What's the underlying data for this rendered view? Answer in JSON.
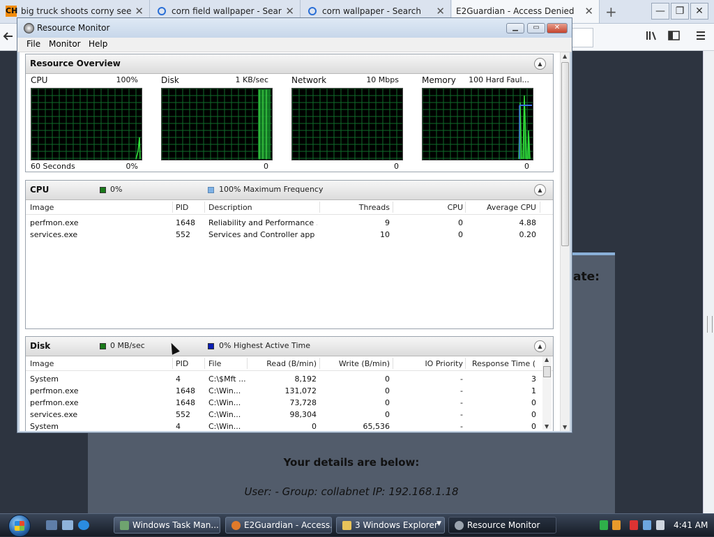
{
  "browser": {
    "tabs": [
      {
        "label": "big truck shoots corny seeds",
        "favicon": "CH",
        "icon": "ch-favicon-icon"
      },
      {
        "label": "corn field wallpaper - Search",
        "icon": "search-icon"
      },
      {
        "label": "corn wallpaper - Search",
        "icon": "search-icon"
      },
      {
        "label": "E2Guardian - Access Denied",
        "active": true
      }
    ],
    "close_glyph": "✕",
    "new_tab_glyph": "+"
  },
  "page": {
    "partial_heading": "ate:",
    "details_heading": "Your details are below:",
    "details_line": "User: -    Group: collabnet    IP: 192.168.1.18"
  },
  "resource_monitor": {
    "title": "Resource Monitor",
    "menu": [
      "File",
      "Monitor",
      "Help"
    ],
    "overview": {
      "title": "Resource Overview",
      "graphs": [
        {
          "name": "CPU",
          "max": "100%",
          "bottom_left": "60 Seconds",
          "bottom_right": "0%"
        },
        {
          "name": "Disk",
          "max": "1 KB/sec",
          "bottom_left": "",
          "bottom_right": "0"
        },
        {
          "name": "Network",
          "max": "10 Mbps",
          "bottom_left": "",
          "bottom_right": "0"
        },
        {
          "name": "Memory",
          "max": "100 Hard Faul...",
          "bottom_left": "",
          "bottom_right": "0"
        }
      ]
    },
    "cpu": {
      "title": "CPU",
      "legend1": "0%",
      "legend2": "100% Maximum Frequency",
      "legend1_color": "#1a7a1a",
      "legend2_color": "#7fb2e5",
      "columns": [
        "Image",
        "PID",
        "Description",
        "Threads",
        "CPU",
        "Average CPU"
      ],
      "rows": [
        [
          "perfmon.exe",
          "1648",
          "Reliability and Performance ...",
          "9",
          "0",
          "4.88"
        ],
        [
          "services.exe",
          "552",
          "Services and Controller app",
          "10",
          "0",
          "0.20"
        ]
      ]
    },
    "disk": {
      "title": "Disk",
      "legend1": "0 MB/sec",
      "legend2": "0% Highest Active Time",
      "legend1_color": "#1a7a1a",
      "legend2_color": "#0a1eb4",
      "columns": [
        "Image",
        "PID",
        "File",
        "Read (B/min)",
        "Write (B/min)",
        "IO Priority",
        "Response Time (..."
      ],
      "rows": [
        [
          "System",
          "4",
          "C:\\$Mft ...",
          "8,192",
          "0",
          "-",
          "3"
        ],
        [
          "perfmon.exe",
          "1648",
          "C:\\Win...",
          "131,072",
          "0",
          "-",
          "1"
        ],
        [
          "perfmon.exe",
          "1648",
          "C:\\Win...",
          "73,728",
          "0",
          "-",
          "0"
        ],
        [
          "services.exe",
          "552",
          "C:\\Win...",
          "98,304",
          "0",
          "-",
          "0"
        ],
        [
          "System",
          "4",
          "C:\\Win...",
          "0",
          "65,536",
          "-",
          "0"
        ]
      ]
    }
  },
  "taskbar": {
    "buttons": [
      {
        "label": "Windows Task Man...",
        "icon": "task-manager-icon"
      },
      {
        "label": "E2Guardian - Access...",
        "icon": "firefox-icon"
      },
      {
        "label": "3 Windows Explorer",
        "icon": "folder-icon"
      },
      {
        "label": "Resource Monitor",
        "icon": "resource-monitor-icon",
        "active": true
      }
    ],
    "clock": "4:41 AM"
  },
  "colors": {
    "graph_grid": "#0f6b2a",
    "graph_line": "#32e03a",
    "page_bg": "#2d3440",
    "card_bg": "#525c6b"
  }
}
